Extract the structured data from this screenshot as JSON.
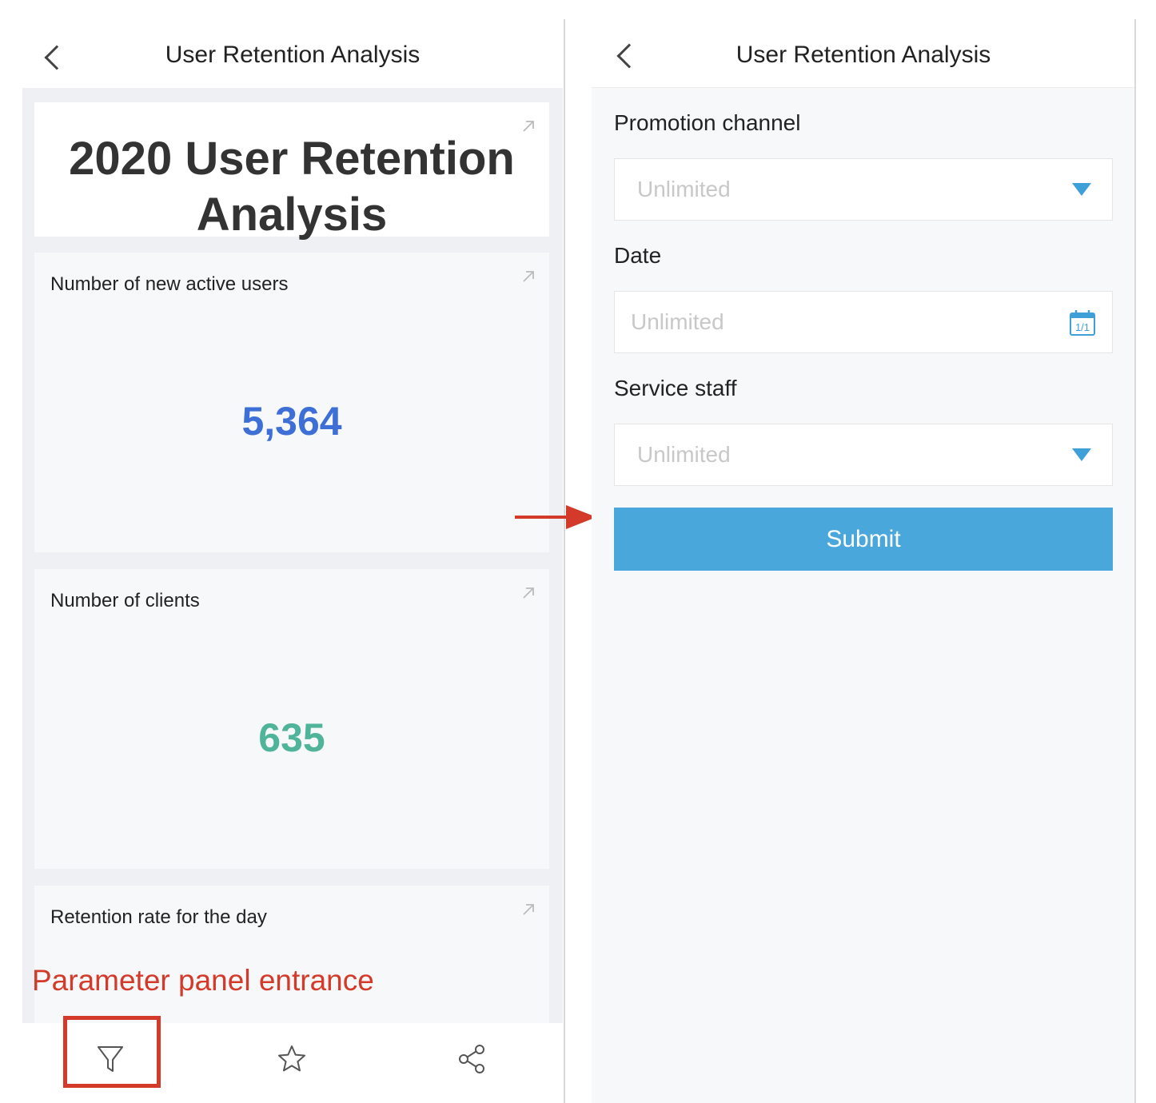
{
  "left_screen": {
    "nav_title": "User Retention Analysis",
    "report_title": "2020 User Retention Analysis",
    "cards": [
      {
        "label": "Number of new active users",
        "value": "5,364",
        "value_color": "#3d6fd6"
      },
      {
        "label": "Number of clients",
        "value": "635",
        "value_color": "#4fb49a"
      },
      {
        "label": "Retention rate for the day",
        "value": ""
      }
    ],
    "toolbar": {
      "icons": [
        "filter-icon",
        "star-icon",
        "share-icon"
      ]
    }
  },
  "annotation": {
    "label": "Parameter panel entrance",
    "color": "#d33a2a"
  },
  "right_screen": {
    "nav_title": "User Retention Analysis",
    "fields": [
      {
        "label": "Promotion channel",
        "placeholder": "Unlimited",
        "control": "dropdown"
      },
      {
        "label": "Date",
        "placeholder": "Unlimited",
        "control": "date"
      },
      {
        "label": "Service staff",
        "placeholder": "Unlimited",
        "control": "dropdown"
      }
    ],
    "submit_label": "Submit",
    "calendar_icon_text": "1/1",
    "accent_color": "#4aa7dc"
  }
}
